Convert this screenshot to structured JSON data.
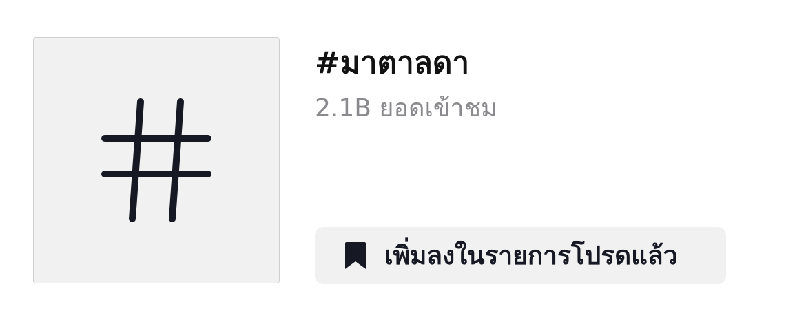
{
  "hashtag": {
    "title": "#มาตาลดา",
    "views": "2.1B ยอดเข้าชม",
    "thumbnail_icon": "hashtag-icon"
  },
  "actions": {
    "add_to_favorites_label": "เพิ่มลงในรายการโปรดแล้ว",
    "add_to_favorites_icon": "bookmark-icon"
  },
  "colors": {
    "background": "#ffffff",
    "thumbnail_bg": "#f1f1f2",
    "title_text": "#121212",
    "secondary_text": "#8a8a8e",
    "icon_dark": "#161823",
    "button_bg": "#f1f1f2"
  }
}
